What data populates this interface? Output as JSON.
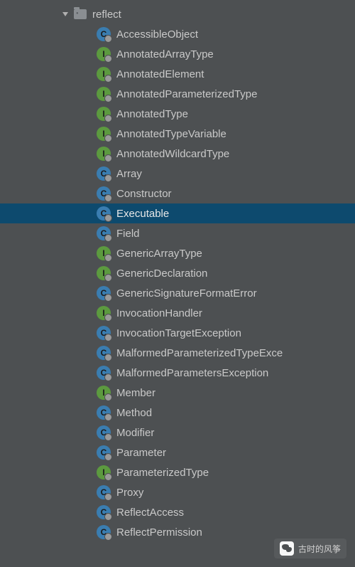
{
  "package": {
    "name": "reflect"
  },
  "items": [
    {
      "type": "class",
      "glyph": "C",
      "label": "AccessibleObject",
      "selected": false
    },
    {
      "type": "interface",
      "glyph": "I",
      "label": "AnnotatedArrayType",
      "selected": false
    },
    {
      "type": "interface",
      "glyph": "I",
      "label": "AnnotatedElement",
      "selected": false
    },
    {
      "type": "interface",
      "glyph": "I",
      "label": "AnnotatedParameterizedType",
      "selected": false
    },
    {
      "type": "interface",
      "glyph": "I",
      "label": "AnnotatedType",
      "selected": false
    },
    {
      "type": "interface",
      "glyph": "I",
      "label": "AnnotatedTypeVariable",
      "selected": false
    },
    {
      "type": "interface",
      "glyph": "I",
      "label": "AnnotatedWildcardType",
      "selected": false
    },
    {
      "type": "class",
      "glyph": "C",
      "label": "Array",
      "selected": false
    },
    {
      "type": "class",
      "glyph": "C",
      "label": "Constructor",
      "selected": false
    },
    {
      "type": "class",
      "glyph": "C",
      "label": "Executable",
      "selected": true
    },
    {
      "type": "class",
      "glyph": "C",
      "label": "Field",
      "selected": false
    },
    {
      "type": "interface",
      "glyph": "I",
      "label": "GenericArrayType",
      "selected": false
    },
    {
      "type": "interface",
      "glyph": "I",
      "label": "GenericDeclaration",
      "selected": false
    },
    {
      "type": "class",
      "glyph": "C",
      "label": "GenericSignatureFormatError",
      "selected": false
    },
    {
      "type": "interface",
      "glyph": "I",
      "label": "InvocationHandler",
      "selected": false
    },
    {
      "type": "class",
      "glyph": "C",
      "label": "InvocationTargetException",
      "selected": false
    },
    {
      "type": "class",
      "glyph": "C",
      "label": "MalformedParameterizedTypeExce",
      "selected": false
    },
    {
      "type": "class",
      "glyph": "C",
      "label": "MalformedParametersException",
      "selected": false
    },
    {
      "type": "interface",
      "glyph": "I",
      "label": "Member",
      "selected": false
    },
    {
      "type": "class",
      "glyph": "C",
      "label": "Method",
      "selected": false
    },
    {
      "type": "class",
      "glyph": "C",
      "label": "Modifier",
      "selected": false
    },
    {
      "type": "class",
      "glyph": "C",
      "label": "Parameter",
      "selected": false
    },
    {
      "type": "interface",
      "glyph": "I",
      "label": "ParameterizedType",
      "selected": false
    },
    {
      "type": "class",
      "glyph": "C",
      "label": "Proxy",
      "selected": false
    },
    {
      "type": "class",
      "glyph": "C",
      "label": "ReflectAccess",
      "selected": false
    },
    {
      "type": "class",
      "glyph": "C",
      "label": "ReflectPermission",
      "selected": false
    }
  ],
  "watermark": {
    "text": "古时的风筝"
  }
}
